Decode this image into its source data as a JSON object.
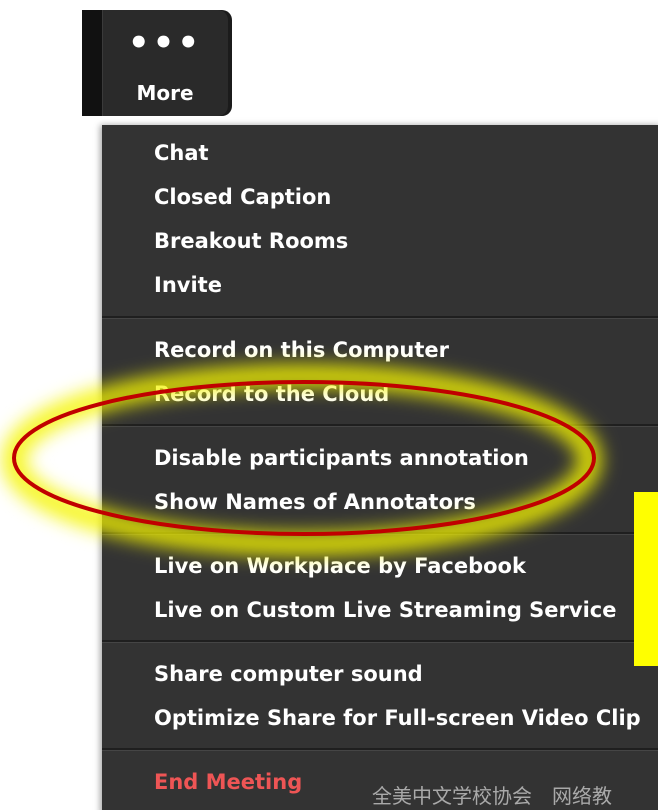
{
  "toolbar": {
    "more_icon": "more-dots-icon",
    "more_dots": "•••",
    "more_label": "More"
  },
  "menu": {
    "groups": [
      [
        "Chat",
        "Closed Caption",
        "Breakout Rooms",
        "Invite"
      ],
      [
        "Record on this Computer",
        "Record to the Cloud"
      ],
      [
        "Disable participants annotation",
        "Show Names of Annotators"
      ],
      [
        "Live on Workplace by Facebook",
        "Live on Custom Live Streaming Service"
      ],
      [
        "Share computer sound",
        "Optimize Share for Full-screen Video Clip"
      ],
      [
        "End Meeting"
      ]
    ],
    "items": {
      "chat": "Chat",
      "closed_caption": "Closed Caption",
      "breakout_rooms": "Breakout Rooms",
      "invite": "Invite",
      "record_computer": "Record on this Computer",
      "record_cloud": "Record to the Cloud",
      "disable_annotation": "Disable participants annotation",
      "show_annotators": "Show Names of Annotators",
      "live_workplace": "Live on Workplace by Facebook",
      "live_custom": "Live on Custom Live Streaming Service",
      "share_sound": "Share computer sound",
      "optimize_share": "Optimize Share for Full-screen Video Clip",
      "end_meeting": "End Meeting"
    }
  },
  "colors": {
    "menu_bg": "#333333",
    "menu_text": "#ffffff",
    "end_meeting": "#ee5555",
    "highlight_glow": "#f4f400",
    "ellipse": "#c00000",
    "side_marker": "#ffff00"
  },
  "watermark": "全美中文学校协会　网络教"
}
